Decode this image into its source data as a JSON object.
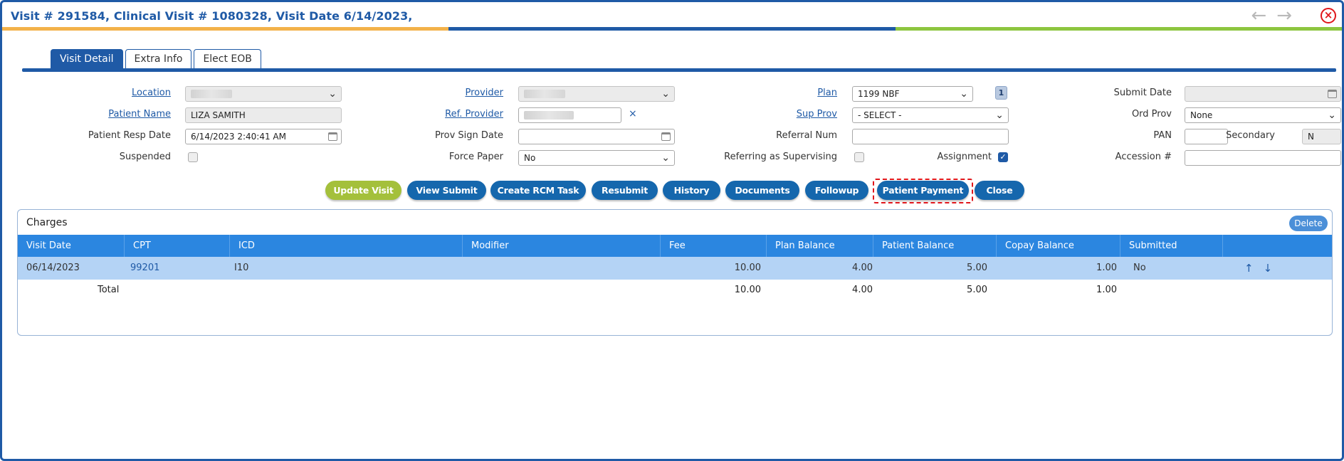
{
  "window": {
    "title": "Visit # 291584, Clinical Visit # 1080328, Visit Date 6/14/2023,",
    "nav_back": "←",
    "nav_forward": "→",
    "close": "×"
  },
  "tabs": [
    {
      "label": "Visit Detail",
      "active": true
    },
    {
      "label": "Extra Info",
      "active": false
    },
    {
      "label": "Elect EOB",
      "active": false
    }
  ],
  "form": {
    "location": {
      "label": "Location",
      "value": ""
    },
    "patient_name": {
      "label": "Patient Name",
      "value": "LIZA SAMITH"
    },
    "patient_resp_date": {
      "label": "Patient Resp Date",
      "value": "6/14/2023 2:40:41 AM"
    },
    "suspended": {
      "label": "Suspended",
      "checked": false
    },
    "provider": {
      "label": "Provider",
      "value": ""
    },
    "ref_provider": {
      "label": "Ref. Provider",
      "value": "",
      "clear": "×"
    },
    "prov_sign_date": {
      "label": "Prov Sign Date",
      "value": ""
    },
    "force_paper": {
      "label": "Force Paper",
      "value": "No"
    },
    "plan": {
      "label": "Plan",
      "value": "1199 NBF",
      "badge": "1"
    },
    "sup_prov": {
      "label": "Sup Prov",
      "value": "- SELECT -"
    },
    "referral_num": {
      "label": "Referral Num",
      "value": ""
    },
    "referring_as_supervising": {
      "label": "Referring as Supervising",
      "checked": false
    },
    "assignment": {
      "label": "Assignment",
      "checked": true
    },
    "submit_date": {
      "label": "Submit Date",
      "value": ""
    },
    "ord_prov": {
      "label": "Ord Prov",
      "value": "None"
    },
    "pan": {
      "label": "PAN",
      "value": ""
    },
    "secondary": {
      "label": "Secondary",
      "value": "N"
    },
    "accession": {
      "label": "Accession #",
      "value": ""
    }
  },
  "actions": [
    "Update Visit",
    "View Submit",
    "Create RCM Task",
    "Resubmit",
    "History",
    "Documents",
    "Followup",
    "Patient Payment",
    "Close"
  ],
  "charges": {
    "title": "Charges",
    "delete_label": "Delete",
    "columns": [
      "Visit Date",
      "CPT",
      "ICD",
      "Modifier",
      "Fee",
      "Plan Balance",
      "Patient Balance",
      "Copay Balance",
      "Submitted"
    ],
    "rows": [
      {
        "visit_date": "06/14/2023",
        "cpt": "99201",
        "icd": "I10",
        "modifier": "",
        "fee": "10.00",
        "plan_balance": "4.00",
        "patient_balance": "5.00",
        "copay_balance": "1.00",
        "submitted": "No"
      }
    ],
    "total": {
      "label": "Total",
      "fee": "10.00",
      "plan_balance": "4.00",
      "patient_balance": "5.00",
      "copay_balance": "1.00"
    },
    "row_up": "↑",
    "row_down": "↓"
  },
  "colors": {
    "primary": "#1f5aa6",
    "button": "#1567ad",
    "button_green": "#a4c03b",
    "highlight": "#e0161b",
    "table_header": "#2b86e0",
    "row_selected": "#b4d3f5"
  }
}
